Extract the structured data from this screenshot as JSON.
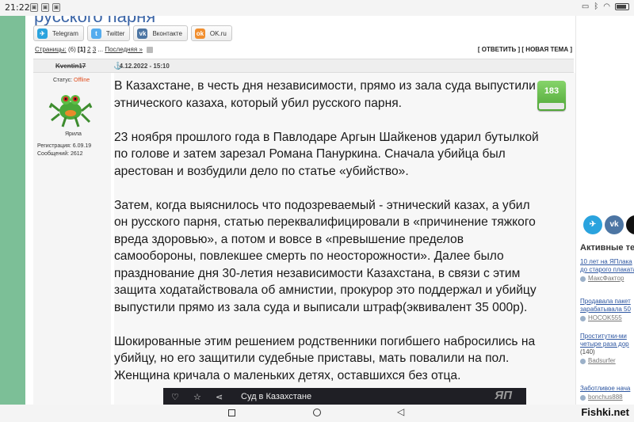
{
  "statusbar": {
    "time": "21:22",
    "icons": [
      "notif-icon",
      "notif-icon",
      "notif-icon"
    ],
    "right_icons": [
      "cast-icon",
      "bluetooth-icon",
      "wifi-icon",
      "battery-icon"
    ]
  },
  "page": {
    "title": "русского парня"
  },
  "share": {
    "buttons": [
      {
        "label": "Telegram",
        "icon": "telegram-icon",
        "glyph": "✈"
      },
      {
        "label": "Twitter",
        "icon": "twitter-icon",
        "glyph": "t"
      },
      {
        "label": "Вконтакте",
        "icon": "vk-icon",
        "glyph": "vk"
      },
      {
        "label": "OK.ru",
        "icon": "ok-icon",
        "glyph": "ok"
      }
    ]
  },
  "pager": {
    "label": "Страницы:",
    "count": "(6)",
    "current": "[1]",
    "page2": "2",
    "page3": "3",
    "ellipsis": "...",
    "last": "Последняя »",
    "reply": "[ ОТВЕТИТЬ ]",
    "new_topic": "[ НОВАЯ ТЕМА ]"
  },
  "post": {
    "author": "Kventin17",
    "date": "4.12.2022 - 15:10",
    "status_label": "Статус:",
    "status_value": "Offline",
    "rank": "Ярила",
    "registration": "Регистрация: 6.09.19",
    "messages": "Сообщений: 2612",
    "rating": "183",
    "paragraphs": [
      "В Казахстане, в честь дня независимости, прямо из зала суда выпустили этнического казаха, который убил русского парня.",
      "23 ноября прошлого года в Павлодаре Аргын Шайкенов ударил бутылкой по голове и затем зарезал Романа Пануркина. Сначала убийца был арестован и возбудили дело по статье «убийство».",
      "Затем, когда выяснилось что подозреваемый - этнический казах, а убил он русского парня, статью переквалифицировали в «причинение тяжкого вреда здоровью», а потом и вовсе в «превышение пределов самообороны, повлекшее смерть по неосторожности». Далее было празднование дня 30-летия независимости Казахстана, в связи с этим защита ходатайствовала об амнистии, прокурор это поддержал и убийцу выпустили прямо из зала суда и выписали штраф(эквивалент 35 000р).",
      "Шокированные этим решением родственники погибшего набросились на убийцу, но его защитили судебные приставы, мать повалили на пол. Женщина кричала о маленьких детях, оставшихся без отца."
    ]
  },
  "video": {
    "title": "Суд в Казахстане",
    "watermark": "ЯП"
  },
  "right": {
    "social": [
      {
        "glyph": "✈",
        "icon": "telegram-icon"
      },
      {
        "glyph": "vk",
        "icon": "vk-icon"
      },
      {
        "glyph": "",
        "icon": "x-icon"
      }
    ],
    "active_title": "Активные те",
    "topics": [
      {
        "title": "10 лет на ЯПлака",
        "title2": "до старого плаката",
        "user": "МаксФактор"
      },
      {
        "title": "Продавала пакет",
        "title2": "зарабатывала 50",
        "user": "HOCOK555"
      },
      {
        "title": "Проститутки-ми",
        "title2": "четыре раза дор",
        "count": "(140)",
        "user": "Badsurfer"
      },
      {
        "title": "Заботливое нача",
        "user": "bonchus888"
      }
    ]
  },
  "navbar": {
    "logo": "Fishki.net"
  }
}
